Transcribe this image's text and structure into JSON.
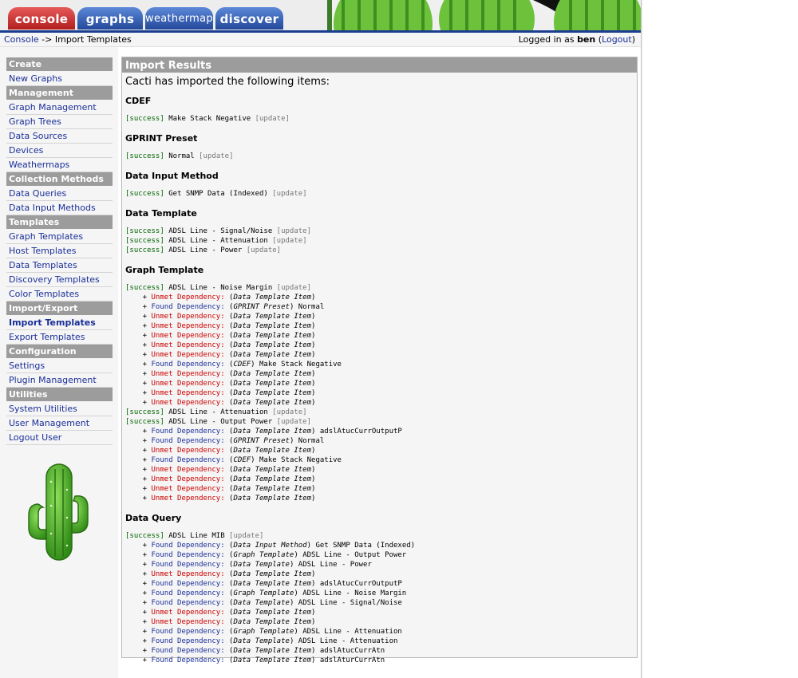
{
  "tabs": [
    "console",
    "graphs",
    "weathermap",
    "discover"
  ],
  "breadcrumb": {
    "link": "Console",
    "separator": "->",
    "current": "Import Templates"
  },
  "login": {
    "prefix": "Logged in as",
    "user": "ben",
    "logout": "Logout"
  },
  "sidebar": [
    {
      "type": "header",
      "label": "Create"
    },
    {
      "type": "item",
      "label": "New Graphs"
    },
    {
      "type": "header",
      "label": "Management"
    },
    {
      "type": "item",
      "label": "Graph Management"
    },
    {
      "type": "item",
      "label": "Graph Trees"
    },
    {
      "type": "item",
      "label": "Data Sources"
    },
    {
      "type": "item",
      "label": "Devices"
    },
    {
      "type": "item",
      "label": "Weathermaps"
    },
    {
      "type": "header",
      "label": "Collection Methods"
    },
    {
      "type": "item",
      "label": "Data Queries"
    },
    {
      "type": "item",
      "label": "Data Input Methods"
    },
    {
      "type": "header",
      "label": "Templates"
    },
    {
      "type": "item",
      "label": "Graph Templates"
    },
    {
      "type": "item",
      "label": "Host Templates"
    },
    {
      "type": "item",
      "label": "Data Templates"
    },
    {
      "type": "item",
      "label": "Discovery Templates"
    },
    {
      "type": "item",
      "label": "Color Templates"
    },
    {
      "type": "header",
      "label": "Import/Export"
    },
    {
      "type": "item",
      "label": "Import Templates",
      "active": true
    },
    {
      "type": "item",
      "label": "Export Templates"
    },
    {
      "type": "header",
      "label": "Configuration"
    },
    {
      "type": "item",
      "label": "Settings"
    },
    {
      "type": "item",
      "label": "Plugin Management"
    },
    {
      "type": "header",
      "label": "Utilities"
    },
    {
      "type": "item",
      "label": "System Utilities"
    },
    {
      "type": "item",
      "label": "User Management"
    },
    {
      "type": "item",
      "label": "Logout User"
    }
  ],
  "results": {
    "title": "Import Results",
    "intro": "Cacti has imported the following items:",
    "labels": {
      "success": "[success]",
      "update": "[update]",
      "unmet": "Unmet Dependency:",
      "found": "Found Dependency:"
    },
    "sections": [
      {
        "title": "CDEF",
        "lines": [
          {
            "kind": "success",
            "name": "Make Stack Negative"
          }
        ]
      },
      {
        "title": "GPRINT Preset",
        "lines": [
          {
            "kind": "success",
            "name": "Normal"
          }
        ]
      },
      {
        "title": "Data Input Method",
        "lines": [
          {
            "kind": "success",
            "name": "Get SNMP Data (Indexed)"
          }
        ]
      },
      {
        "title": "Data Template",
        "lines": [
          {
            "kind": "success",
            "name": "ADSL Line - Signal/Noise"
          },
          {
            "kind": "success",
            "name": "ADSL Line - Attenuation"
          },
          {
            "kind": "success",
            "name": "ADSL Line - Power"
          }
        ]
      },
      {
        "title": "Graph Template",
        "lines": [
          {
            "kind": "success",
            "name": "ADSL Line - Noise Margin"
          },
          {
            "kind": "unmet",
            "type": "Data Template Item",
            "name": ""
          },
          {
            "kind": "found",
            "type": "GPRINT Preset",
            "name": "Normal"
          },
          {
            "kind": "unmet",
            "type": "Data Template Item",
            "name": ""
          },
          {
            "kind": "unmet",
            "type": "Data Template Item",
            "name": ""
          },
          {
            "kind": "unmet",
            "type": "Data Template Item",
            "name": ""
          },
          {
            "kind": "unmet",
            "type": "Data Template Item",
            "name": ""
          },
          {
            "kind": "unmet",
            "type": "Data Template Item",
            "name": ""
          },
          {
            "kind": "found",
            "type": "CDEF",
            "name": "Make Stack Negative"
          },
          {
            "kind": "unmet",
            "type": "Data Template Item",
            "name": ""
          },
          {
            "kind": "unmet",
            "type": "Data Template Item",
            "name": ""
          },
          {
            "kind": "unmet",
            "type": "Data Template Item",
            "name": ""
          },
          {
            "kind": "unmet",
            "type": "Data Template Item",
            "name": ""
          },
          {
            "kind": "success",
            "name": "ADSL Line - Attenuation"
          },
          {
            "kind": "success",
            "name": "ADSL Line - Output Power"
          },
          {
            "kind": "found",
            "type": "Data Template Item",
            "name": "adslAtucCurrOutputP"
          },
          {
            "kind": "found",
            "type": "GPRINT Preset",
            "name": "Normal"
          },
          {
            "kind": "unmet",
            "type": "Data Template Item",
            "name": ""
          },
          {
            "kind": "found",
            "type": "CDEF",
            "name": "Make Stack Negative"
          },
          {
            "kind": "unmet",
            "type": "Data Template Item",
            "name": ""
          },
          {
            "kind": "unmet",
            "type": "Data Template Item",
            "name": ""
          },
          {
            "kind": "unmet",
            "type": "Data Template Item",
            "name": ""
          },
          {
            "kind": "unmet",
            "type": "Data Template Item",
            "name": ""
          }
        ]
      },
      {
        "title": "Data Query",
        "lines": [
          {
            "kind": "success",
            "name": "ADSL Line MIB"
          },
          {
            "kind": "found",
            "type": "Data Input Method",
            "name": "Get SNMP Data (Indexed)"
          },
          {
            "kind": "found",
            "type": "Graph Template",
            "name": "ADSL Line - Output Power"
          },
          {
            "kind": "found",
            "type": "Data Template",
            "name": "ADSL Line - Power"
          },
          {
            "kind": "unmet",
            "type": "Data Template Item",
            "name": ""
          },
          {
            "kind": "found",
            "type": "Data Template Item",
            "name": "adslAtucCurrOutputP"
          },
          {
            "kind": "found",
            "type": "Graph Template",
            "name": "ADSL Line - Noise Margin"
          },
          {
            "kind": "found",
            "type": "Data Template",
            "name": "ADSL Line - Signal/Noise"
          },
          {
            "kind": "unmet",
            "type": "Data Template Item",
            "name": ""
          },
          {
            "kind": "unmet",
            "type": "Data Template Item",
            "name": ""
          },
          {
            "kind": "found",
            "type": "Graph Template",
            "name": "ADSL Line - Attenuation"
          },
          {
            "kind": "found",
            "type": "Data Template",
            "name": "ADSL Line - Attenuation"
          },
          {
            "kind": "found",
            "type": "Data Template Item",
            "name": "adslAtucCurrAtn"
          },
          {
            "kind": "found",
            "type": "Data Template Item",
            "name": "adslAturCurrAtn"
          }
        ]
      }
    ]
  },
  "colors": {
    "success": "#006400",
    "unmet": "#cc0000",
    "found": "#1a2f99",
    "header_bg": "#9c9c9c",
    "tab_active": "#c62c2c",
    "tab": "#2d57b0"
  }
}
